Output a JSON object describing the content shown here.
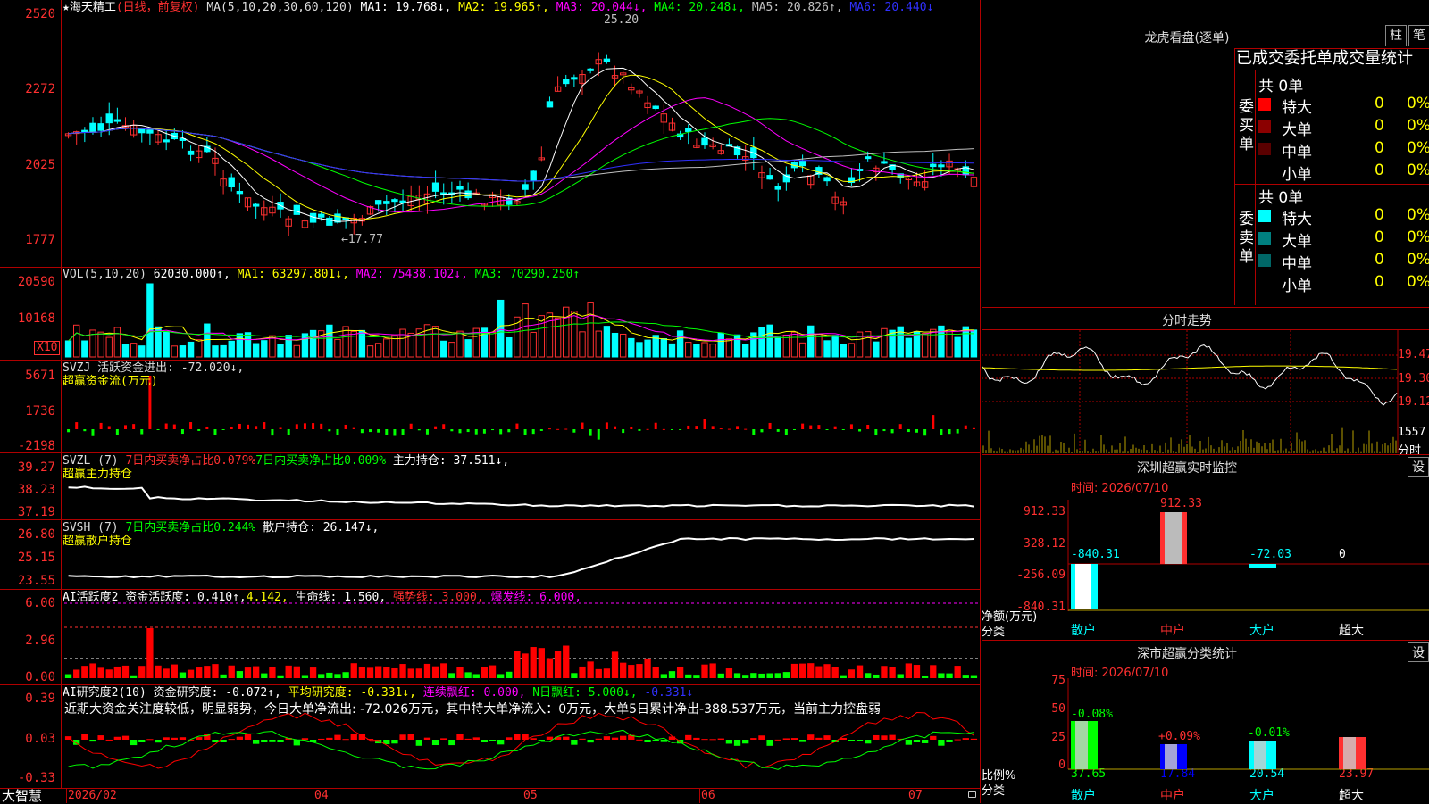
{
  "colors": {
    "up": "#ff3030",
    "down": "#00ffff",
    "grid": "#b00000",
    "bg": "#000000"
  },
  "main": {
    "star": "★",
    "stock_name": "海天精工",
    "mode": "(日线，前复权)",
    "ma_header": "MA(5,10,20,30,60,120)",
    "ma1": "MA1: 19.768↓,",
    "ma2": "MA2: 19.965↑,",
    "ma3": "MA3: 20.044↓,",
    "ma4": "MA4: 20.248↓,",
    "ma5": "MA5: 20.826↑,",
    "ma6": "MA6: 20.440↓",
    "high_label": "25.20",
    "low_label": "←17.77",
    "yticks": [
      "2520",
      "2272",
      "2025",
      "1777"
    ]
  },
  "vol": {
    "header": "VOL(5,10,20)",
    "value": "62030.000↑,",
    "ma1": "MA1: 63297.801↓,",
    "ma2": "MA2: 75438.102↓,",
    "ma3": "MA3: 70290.250↑",
    "yticks": [
      "20590",
      "10168"
    ],
    "unit": "X10"
  },
  "svzj": {
    "header": "SVZJ  活跃资金进出: -72.020↓,",
    "sub": "超赢资金流(万元)",
    "yticks": [
      "5671",
      "1736",
      "-2198"
    ]
  },
  "svzl": {
    "header": "SVZL (7)",
    "p1": "7日内买卖净占比0.079%",
    "p2": "7日内买卖净占比0.009%",
    "p3": "主力持仓: 37.511↓,",
    "sub": "超赢主力持仓",
    "yticks": [
      "39.27",
      "38.23",
      "37.19"
    ]
  },
  "svsh": {
    "header": "SVSH (7)",
    "p1": "7日内买卖净占比0.244%",
    "p2": "散户持仓: 26.147↓,",
    "sub": "超赢散户持仓",
    "yticks": [
      "26.80",
      "25.15",
      "23.55"
    ]
  },
  "ai1": {
    "header": "AI活跃度2 资金活跃度: 0.410↑,",
    "v2": "4.142,",
    "v3": "生命线: 1.560,",
    "v4": "强势线: 3.000,",
    "v5": "爆发线: 6.000,",
    "yticks": [
      "6.00",
      "2.96",
      "0.00"
    ]
  },
  "ai2": {
    "header": "AI研究度2(10) 资金研究度: -0.072↑,",
    "v2": "平均研究度: -0.331↓,",
    "v3": "连续飘红: 0.000,",
    "v4": "N日飘红: 5.000↓,",
    "v5": "-0.331↓",
    "note": "近期大资金关注度较低，明显弱势，今日大单净流出: -72.026万元，其中特大单净流入：0万元，大单5日累计净出-388.537万元，当前主力控盘弱",
    "yticks": [
      "0.39",
      "0.03",
      "-0.33"
    ]
  },
  "xaxis": {
    "brand": "大智慧",
    "labels": [
      "2026/02",
      "04",
      "05",
      "06",
      "07"
    ]
  },
  "lhb": {
    "title": "龙虎看盘(逐单)",
    "btn1": "柱",
    "btn2": "笔",
    "subtitle": "已成交委托单成交量统计",
    "buy_total": "共 0单",
    "sell_total": "共 0单",
    "buy_label": "委买单",
    "sell_label": "委卖单",
    "buy_rows": [
      {
        "name": "特大",
        "v": "0",
        "p": "0%",
        "color": "#ff0000"
      },
      {
        "name": "大单",
        "v": "0",
        "p": "0%",
        "color": "#8b0000"
      },
      {
        "name": "中单",
        "v": "0",
        "p": "0%",
        "color": "#5a0000"
      },
      {
        "name": "小单",
        "v": "0",
        "p": "0%",
        "color": "#000000"
      }
    ],
    "sell_rows": [
      {
        "name": "特大",
        "v": "0",
        "p": "0%",
        "color": "#00ffff"
      },
      {
        "name": "大单",
        "v": "0",
        "p": "0%",
        "color": "#008080"
      },
      {
        "name": "中单",
        "v": "0",
        "p": "0%",
        "color": "#006666"
      },
      {
        "name": "小单",
        "v": "0",
        "p": "0%",
        "color": "#000000"
      }
    ]
  },
  "fs": {
    "title": "分时走势",
    "yticks": [
      "19.47",
      "19.30",
      "19.12"
    ],
    "vol": "1557",
    "unit": "分时"
  },
  "szm": {
    "title": "深圳超赢实时监控",
    "btn": "设",
    "time": "时间: 2026/07/10",
    "yticks": [
      "912.33",
      "328.12",
      "-256.09",
      "-840.31"
    ],
    "vals": [
      "-840.31",
      "912.33",
      "-72.03",
      "0"
    ],
    "cats": [
      "散户",
      "中户",
      "大户",
      "超大"
    ],
    "ylabel1": "净额(万元)",
    "ylabel2": "分类"
  },
  "szc": {
    "title": "深市超赢分类统计",
    "btn": "设",
    "time": "时间: 2026/07/10",
    "yticks": [
      "75",
      "50",
      "25",
      "0"
    ],
    "vals": [
      "37.65",
      "17.84",
      "20.54",
      "23.97"
    ],
    "chg": [
      "-0.08%",
      "+0.09%",
      "-0.01%",
      ""
    ],
    "cats": [
      "散户",
      "中户",
      "大户",
      "超大"
    ],
    "ylabel1": "比例%",
    "ylabel2": "分类"
  }
}
